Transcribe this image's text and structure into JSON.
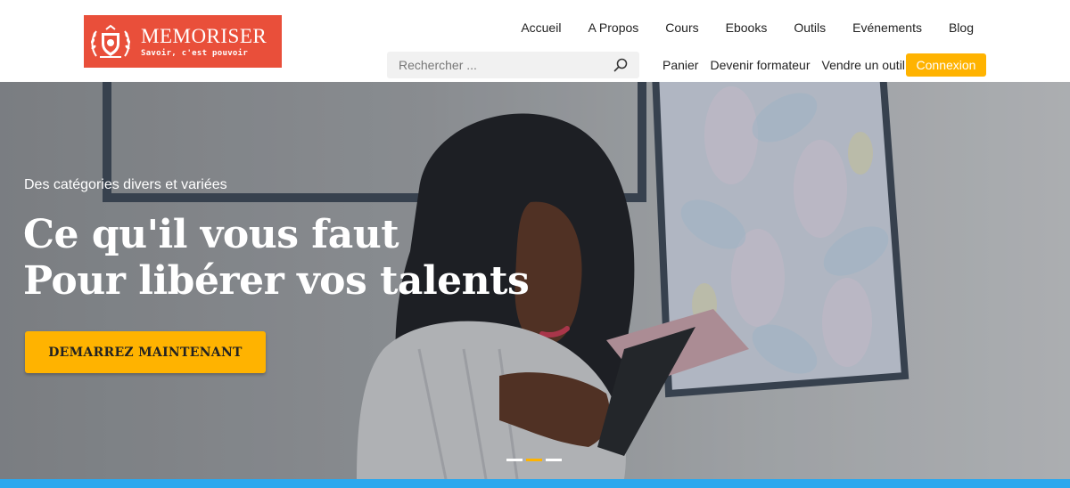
{
  "brand": {
    "name": "MEMORISER",
    "tagline": "Savoir, c'est pouvoir",
    "color": "#e94f3a",
    "icon": "shield-laurel-icon"
  },
  "nav": {
    "items": [
      {
        "label": "Accueil"
      },
      {
        "label": "A Propos"
      },
      {
        "label": "Cours"
      },
      {
        "label": "Ebooks"
      },
      {
        "label": "Outils"
      },
      {
        "label": "Evénements"
      },
      {
        "label": "Blog"
      }
    ]
  },
  "search": {
    "placeholder": "Rechercher ...",
    "icon": "search-icon"
  },
  "subnav": {
    "cart": "Panier",
    "become_trainer": "Devenir formateur",
    "sell_tool": "Vendre un outil",
    "login": "Connexion"
  },
  "hero": {
    "kicker": "Des catégories divers et variées",
    "title_line1": "Ce qu'il vous faut",
    "title_line2": "Pour libérer vos talents",
    "cta": "DEMARREZ MAINTENANT",
    "slides": {
      "count": 3,
      "active_index": 1
    }
  },
  "colors": {
    "accent": "#ffb300",
    "brand": "#e94f3a",
    "footer_strip": "#2ba8ee"
  }
}
